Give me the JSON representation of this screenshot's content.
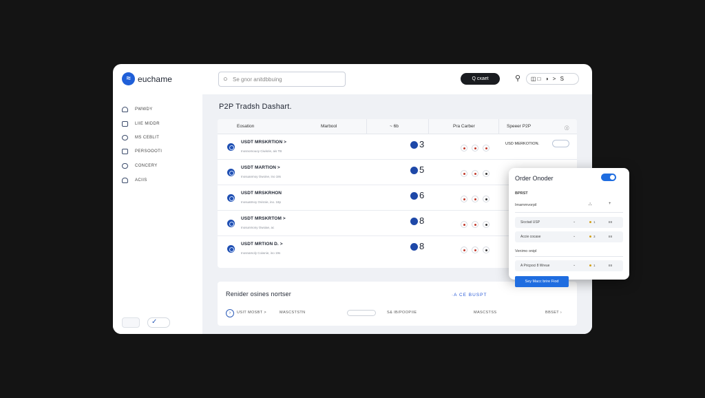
{
  "brand": {
    "name": "euchame"
  },
  "topbar": {
    "search_placeholder": "Se gnor anitdbbuing",
    "action_button": "Q cxaet",
    "tools": "◫□ ◑ > S"
  },
  "sidebar": {
    "items": [
      {
        "label": "PWWDY"
      },
      {
        "label": "LIIE MIDDR"
      },
      {
        "label": "MS CEBLIT"
      },
      {
        "label": "PERSOOOTI"
      },
      {
        "label": "CONCERY"
      },
      {
        "label": "ACIIS"
      }
    ]
  },
  "main": {
    "title": "P2P Tradsh Dashart.",
    "table": {
      "headers": [
        "Eosation",
        "Marbool",
        "~ 6b",
        "Pra Carber",
        "Speeer P2P"
      ],
      "rows": [
        {
          "name": "USDT MRSKRTION  >",
          "sub": "Inosnomouoy Ciwisrie, ais TB",
          "qty": "3",
          "pair": "USD MERKOTION."
        },
        {
          "name": "USDT MARTION  >",
          "sub": "Inosuanmoy Owoine, ino 18s",
          "qty": "5",
          "pair": ""
        },
        {
          "name": "USDT MRSKRHON",
          "sub": "Inosuatmoy Ovisnie, ino. 18p",
          "qty": "6",
          "pair": ""
        },
        {
          "name": "USDT MRSKRTOM  >",
          "sub": "Inosunmony Owoiae, ac",
          "qty": "8",
          "pair": ""
        },
        {
          "name": "USDT MRTION  D. >",
          "sub": "Inosnamoly Coiwnie, ino 19s",
          "qty": "8",
          "pair": ""
        }
      ]
    },
    "reminder": {
      "title": "Renider osines nortser",
      "link": "·A CE BUSPT",
      "fields": [
        "USIT MOSBT  >",
        "MASCSTSTN",
        "S& IB/POOPIIE",
        "MASCSTSS",
        "BBSET  ›"
      ]
    }
  },
  "order_panel": {
    "title": "Order Onoder",
    "section_1": "BPRST",
    "section_2": "Imammvorpil",
    "fields": [
      {
        "label": "Sicctad USP",
        "v1": "1",
        "v2": "IIII"
      },
      {
        "label": "Accie cocase",
        "v1": "3",
        "v2": "IIII"
      }
    ],
    "section_3": "Venimo onipl",
    "field_3": {
      "label": "A Pricpoci 8 Wreue",
      "v1": "1",
      "v2": "IIII"
    },
    "submit": "Sey Macc brire Fiod",
    "colors": {
      "accent": "#1f6de0"
    }
  }
}
